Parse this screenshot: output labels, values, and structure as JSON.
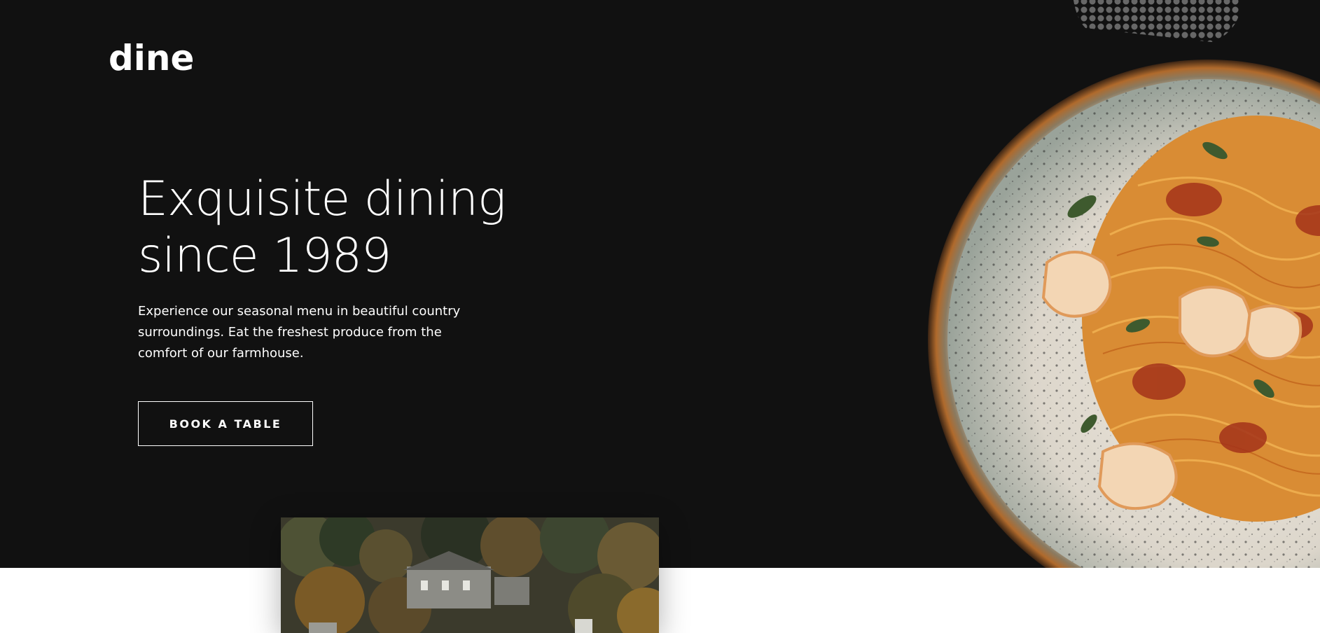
{
  "brand": {
    "logo_text": "dine"
  },
  "hero": {
    "headline_line1": "Exquisite dining",
    "headline_line2": "since 1989",
    "description": "Experience our seasonal menu in beautiful country surroundings. Eat the freshest produce from the comfort of our farmhouse.",
    "cta_label": "BOOK A TABLE"
  },
  "colors": {
    "hero_bg": "#111111",
    "text": "#ffffff",
    "page_bg": "#ffffff"
  },
  "images": {
    "hero_dish": "pasta-shrimp-plate-image",
    "farmhouse": "farmhouse-woods-image",
    "decoration": "dot-pattern-decoration"
  }
}
